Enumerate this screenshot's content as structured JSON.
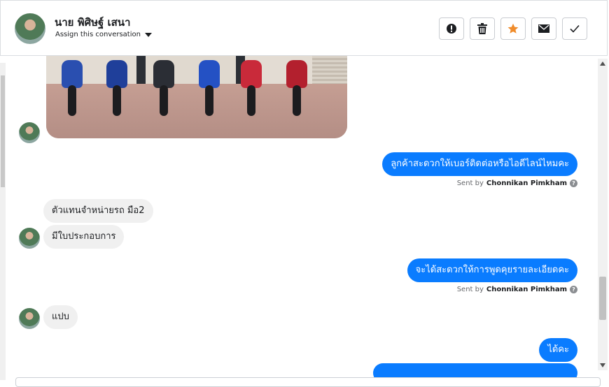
{
  "header": {
    "contact_name": "นาย พิศิษฐ์ เสนา",
    "assign_label": "Assign this conversation",
    "actions": [
      {
        "icon": "spam-icon",
        "label": "Mark as spam"
      },
      {
        "icon": "trash-icon",
        "label": "Delete"
      },
      {
        "icon": "star-icon",
        "label": "Star"
      },
      {
        "icon": "envelope-icon",
        "label": "Mark unread"
      },
      {
        "icon": "check-icon",
        "label": "Mark done"
      }
    ],
    "star_color": "#f08c2b"
  },
  "messages": [
    {
      "from": "contact",
      "type": "image",
      "alt": ""
    },
    {
      "from": "page",
      "text": "ลูกค้าสะดวกให้เบอร์ติดต่อหรือไอดีไลน์ไหมคะ",
      "sent_by_prefix": "Sent by",
      "sender": "Chonnikan Pimkham"
    },
    {
      "from": "contact",
      "text": "ตัวแทนจำหน่ายรถ มือ2"
    },
    {
      "from": "contact",
      "text": "มีใบประกอบการ"
    },
    {
      "from": "page",
      "text": "จะได้สะดวกให้การพูดคุยรายละเอียดคะ",
      "sent_by_prefix": "Sent by",
      "sender": "Chonnikan Pimkham"
    },
    {
      "from": "contact",
      "text": "แปบ"
    },
    {
      "from": "page",
      "text": "ได้คะ"
    }
  ],
  "colors": {
    "outgoing": "#0a7cff",
    "incoming": "#f0f0f0"
  }
}
